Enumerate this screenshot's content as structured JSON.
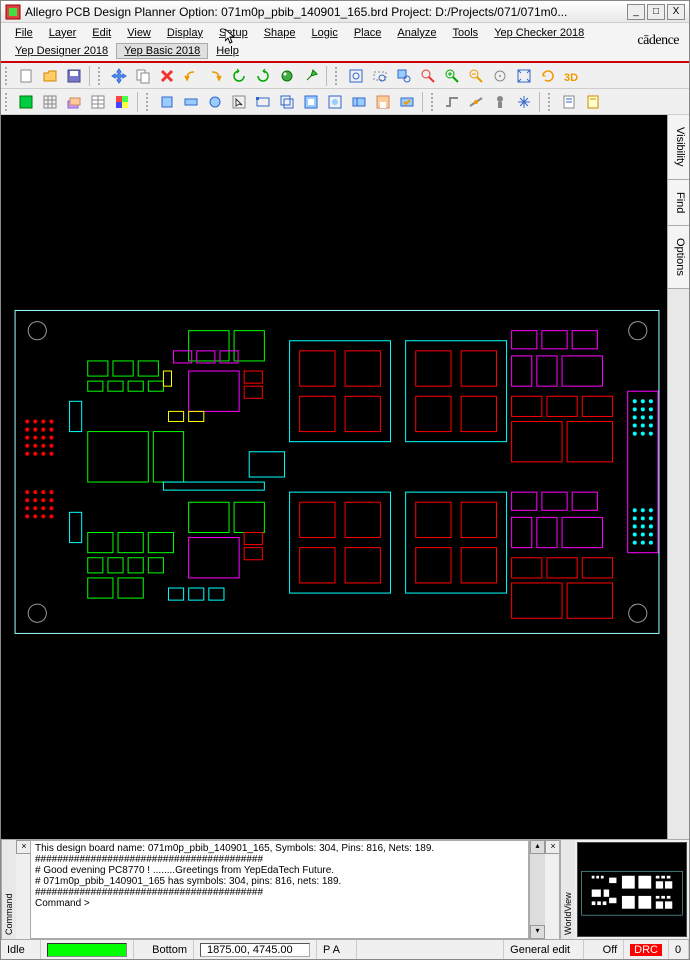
{
  "title": "Allegro PCB Design Planner Option: 071m0p_pbib_140901_165.brd   Project: D:/Projects/071/071m0...",
  "menus": {
    "row1": [
      "File",
      "Layer",
      "Edit",
      "View",
      "Display",
      "Setup",
      "Shape",
      "Logic",
      "Place",
      "Analyze",
      "Tools",
      "Yep Checker 2018"
    ],
    "row2": [
      "Yep Designer 2018",
      "Yep Basic 2018",
      "Help"
    ]
  },
  "brand": "cādence",
  "sideTabs": [
    "Visibility",
    "Find",
    "Options"
  ],
  "cmdLog": "This design board name: 071m0p_pbib_140901_165, Symbols: 304, Pins: 816, Nets: 189.\n#########################################\n#  Good evening PC8770 !      ........Greetings from YepEdaTech Future.\n#  071m0p_pbib_140901_165 has symbols: 304, pins: 816, nets: 189.\n#########################################\nCommand >",
  "cmdTabLabel": "Command",
  "wvTabLabel": "WorldView",
  "status": {
    "state": "Idle",
    "layer": "Bottom",
    "coords": "1875.00, 4745.00",
    "pa": "P  A",
    "mode": "General edit",
    "drcState": "Off",
    "drcLabel": "DRC",
    "drcCount": "0"
  },
  "winBtns": {
    "min": "_",
    "max": "□",
    "close": "X"
  }
}
